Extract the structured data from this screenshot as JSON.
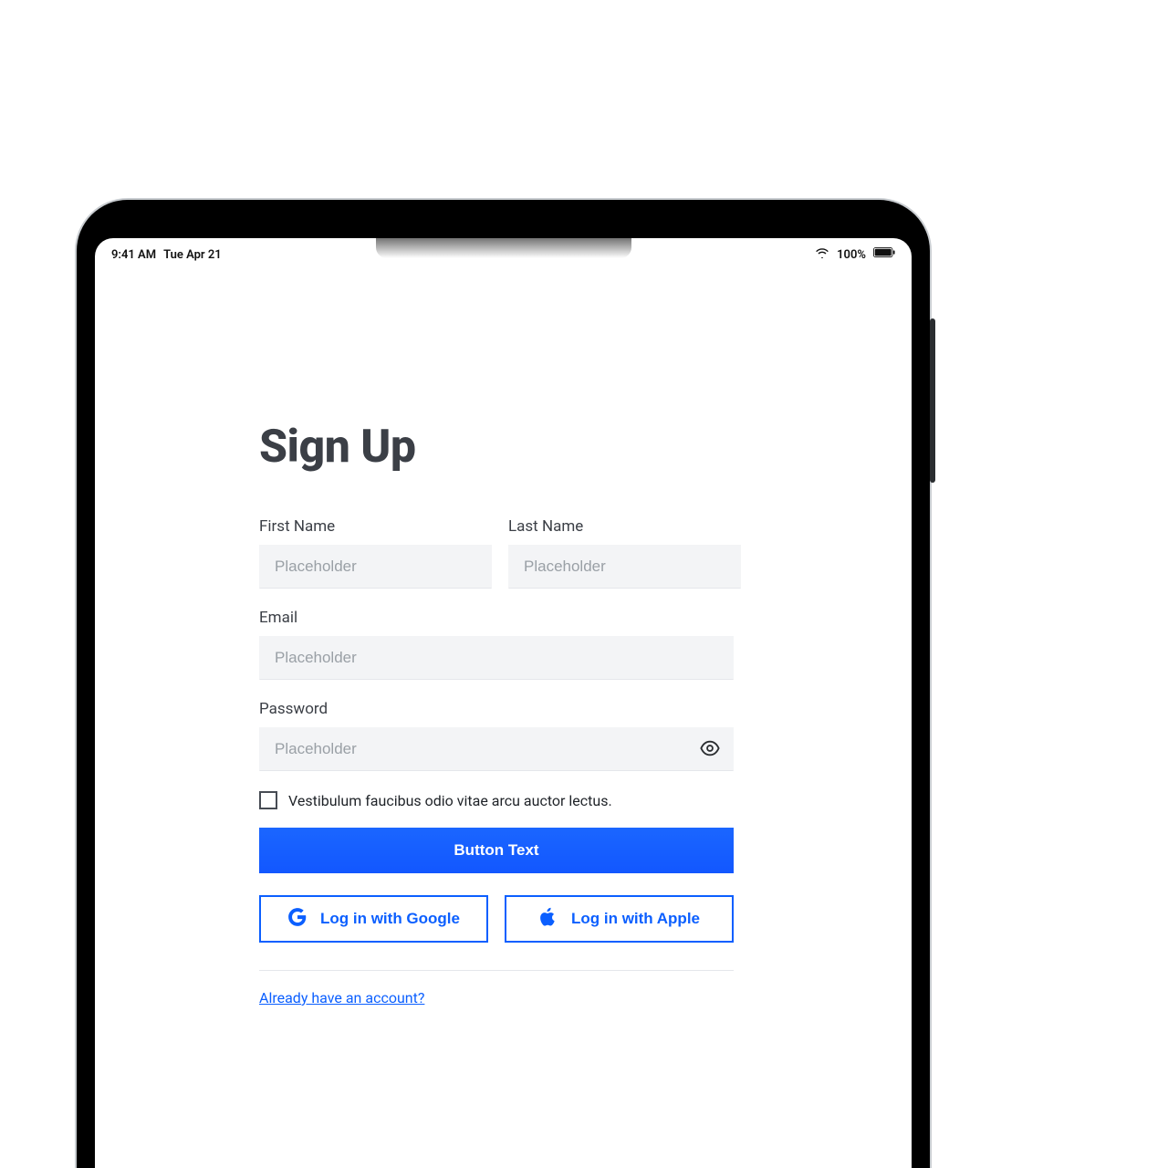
{
  "status": {
    "time": "9:41 AM",
    "date": "Tue Apr 21",
    "battery_pct": "100%"
  },
  "form": {
    "title": "Sign Up",
    "first_name_label": "First Name",
    "first_name_placeholder": "Placeholder",
    "last_name_label": "Last Name",
    "last_name_placeholder": "Placeholder",
    "email_label": "Email",
    "email_placeholder": "Placeholder",
    "password_label": "Password",
    "password_placeholder": "Placeholder",
    "checkbox_label": "Vestibulum faucibus odio vitae arcu auctor lectus.",
    "submit_label": "Button Text",
    "google_label": "Log in with Google",
    "apple_label": "Log in with Apple",
    "already_text": "Already have an account?"
  },
  "colors": {
    "accent": "#0b5fff"
  }
}
